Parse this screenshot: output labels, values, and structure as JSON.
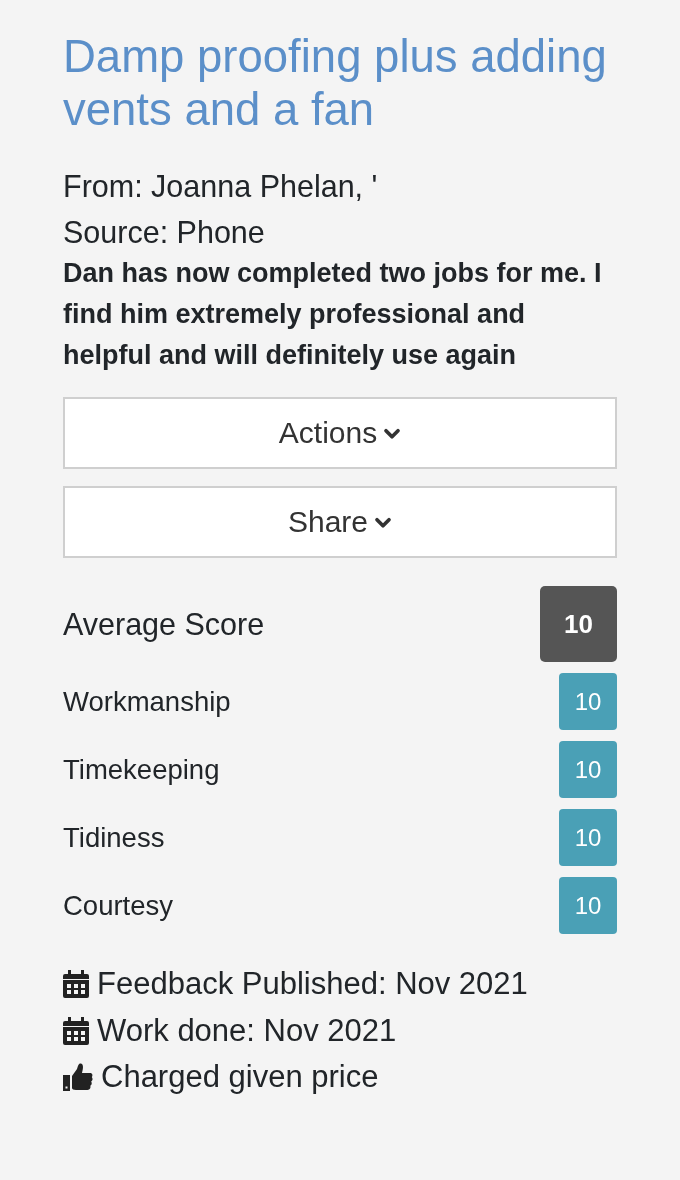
{
  "review": {
    "title": "Damp proofing plus adding vents and a fan",
    "from": "From: Joanna Phelan, '",
    "source": "Source: Phone",
    "comment": "Dan has now completed two jobs for me. I find him extremely professional and helpful and will definitely use again"
  },
  "buttons": [
    {
      "label": "Actions"
    },
    {
      "label": "Share"
    }
  ],
  "average_score": {
    "label": "Average Score",
    "value": "10"
  },
  "scores": [
    {
      "label": "Workmanship",
      "value": "10"
    },
    {
      "label": "Timekeeping",
      "value": "10"
    },
    {
      "label": "Tidiness",
      "value": "10"
    },
    {
      "label": "Courtesy",
      "value": "10"
    }
  ],
  "details": [
    {
      "kind": "calendar",
      "text": "Feedback Published: Nov 2021"
    },
    {
      "kind": "calendar",
      "text": "Work done: Nov 2021"
    },
    {
      "kind": "thumbs-up",
      "text": "Charged given price"
    }
  ]
}
